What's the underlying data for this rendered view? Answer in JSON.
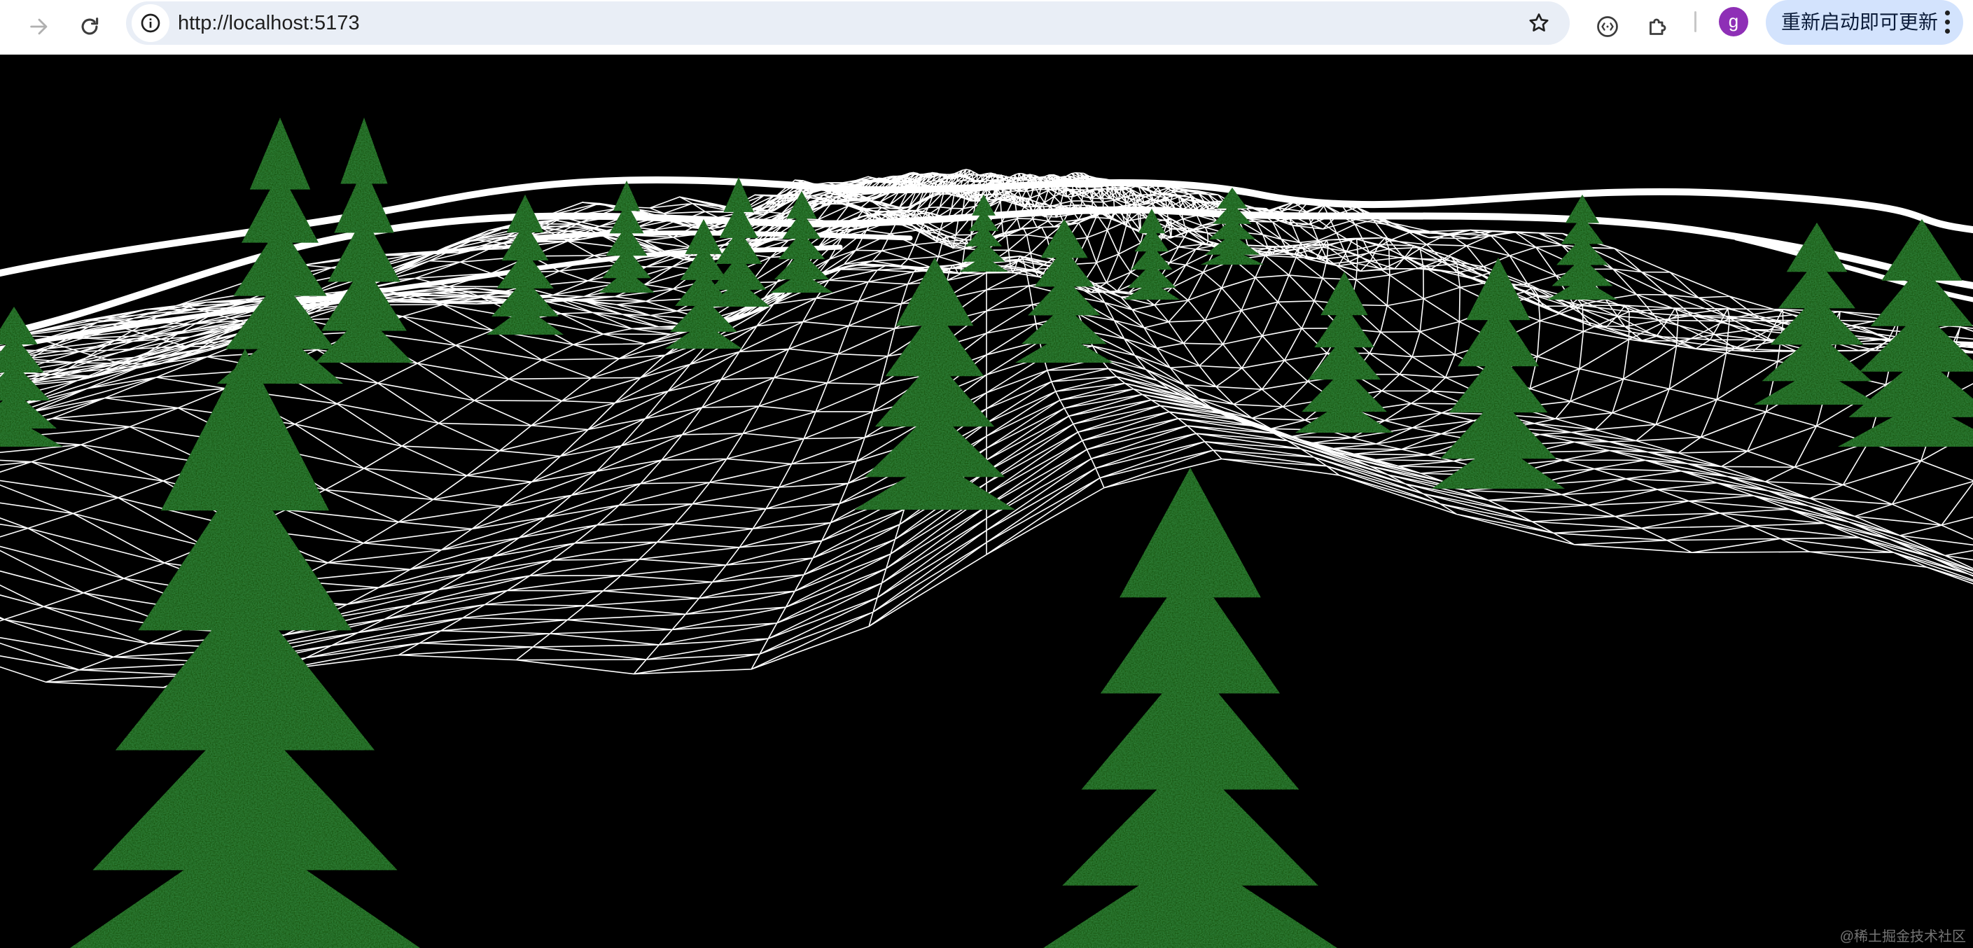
{
  "browser": {
    "url": "http://localhost:5173",
    "profile_initial": "g",
    "update_button_label": "重新启动即可更新",
    "icons": {
      "forward": "arrow-right-icon",
      "reload": "reload-icon",
      "site_info": "info-icon",
      "bookmark": "star-icon",
      "media": "media-control-icon",
      "extensions": "puzzle-icon",
      "menu": "kebab-menu-icon"
    }
  },
  "scene": {
    "background_color": "#000000",
    "wireframe_color": "#ffffff",
    "tree_color": "#1f5a17",
    "watermark": "@稀土掘金技术社区"
  }
}
